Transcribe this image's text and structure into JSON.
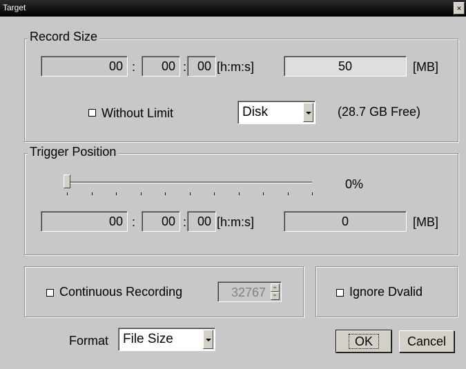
{
  "window": {
    "title": "Target",
    "close_glyph": "×"
  },
  "record_size": {
    "title": "Record Size",
    "time": {
      "h": "00",
      "m": "00",
      "s": "00",
      "sep": ":",
      "unit": "[h:m:s]"
    },
    "size_value": "50",
    "size_unit": "[MB]",
    "without_limit_label": "Without Limit",
    "without_limit_checked": false,
    "target_select": {
      "value": "Disk"
    },
    "free_space": "(28.7 GB Free)"
  },
  "trigger_position": {
    "title": "Trigger Position",
    "slider_percent": 0,
    "percent_label": "0%",
    "time": {
      "h": "00",
      "m": "00",
      "s": "00",
      "sep": ":",
      "unit": "[h:m:s]"
    },
    "size_value": "0",
    "size_unit": "[MB]"
  },
  "continuous": {
    "label": "Continuous Recording",
    "checked": false,
    "count_value": "32767"
  },
  "ignore_dvalid": {
    "label": "Ignore Dvalid",
    "checked": false
  },
  "format": {
    "label": "Format",
    "value": "File Size"
  },
  "buttons": {
    "ok": "OK",
    "cancel": "Cancel"
  }
}
